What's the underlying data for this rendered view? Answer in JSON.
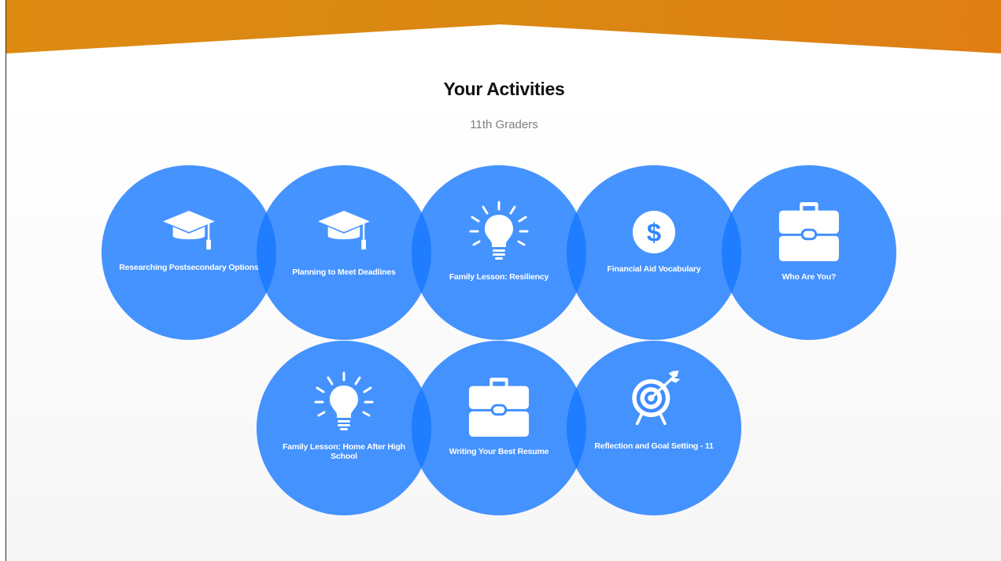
{
  "header": {
    "title": "Your Activities",
    "subtitle": "11th Graders"
  },
  "colors": {
    "banner_orange": "#dc8a12",
    "tile_blue": "#1678ff",
    "title_text": "#111111",
    "subtitle_text": "#7f7f7f"
  },
  "activities": [
    {
      "label": "Researching Postsecondary Options",
      "icon": "graduation-cap-icon"
    },
    {
      "label": "Planning to Meet Deadlines",
      "icon": "graduation-cap-icon"
    },
    {
      "label": "Family Lesson: Resiliency",
      "icon": "lightbulb-icon"
    },
    {
      "label": "Financial Aid Vocabulary",
      "icon": "dollar-icon"
    },
    {
      "label": "Who Are You?",
      "icon": "briefcase-icon"
    },
    {
      "label": "Family Lesson: Home After High School",
      "icon": "lightbulb-icon"
    },
    {
      "label": "Writing Your Best Resume",
      "icon": "briefcase-icon"
    },
    {
      "label": "Reflection and Goal Setting - 11",
      "icon": "target-icon"
    }
  ]
}
